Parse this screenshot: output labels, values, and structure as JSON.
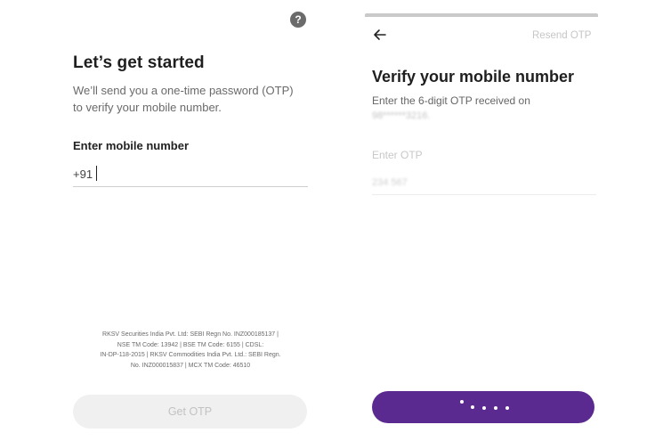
{
  "left_screen": {
    "help_icon_glyph": "?",
    "title": "Let’s get started",
    "subtitle_line1": "We’ll send you a one-time password (OTP)",
    "subtitle_line2": "to verify your mobile number.",
    "mobile_label": "Enter mobile number",
    "country_code": "+91",
    "mobile_value": "",
    "disclaimer_lines": [
      "RKSV Securities India Pvt. Ltd: SEBI Regn No. INZ000185137 |",
      "NSE TM Code: 13942 | BSE TM Code: 6155 | CDSL:",
      "IN-DP-118-2015 | RKSV Commodities India Pvt. Ltd.: SEBI Regn.",
      "No. INZ000015837 | MCX TM Code: 46510"
    ],
    "get_otp_label": "Get OTP"
  },
  "right_screen": {
    "resend_label": "Resend OTP",
    "title": "Verify your mobile number",
    "subtitle": "Enter the 6-digit OTP received on",
    "masked_number": "98******3216.",
    "otp_label": "Enter OTP",
    "otp_value": "234 567",
    "button_state": "loading"
  },
  "colors": {
    "accent": "#5b2a91",
    "disabled_button": "#f0f0f0",
    "muted_text": "#c6c6c6"
  },
  "icons": {
    "help": "help-circle-icon",
    "back": "arrow-left-icon"
  }
}
